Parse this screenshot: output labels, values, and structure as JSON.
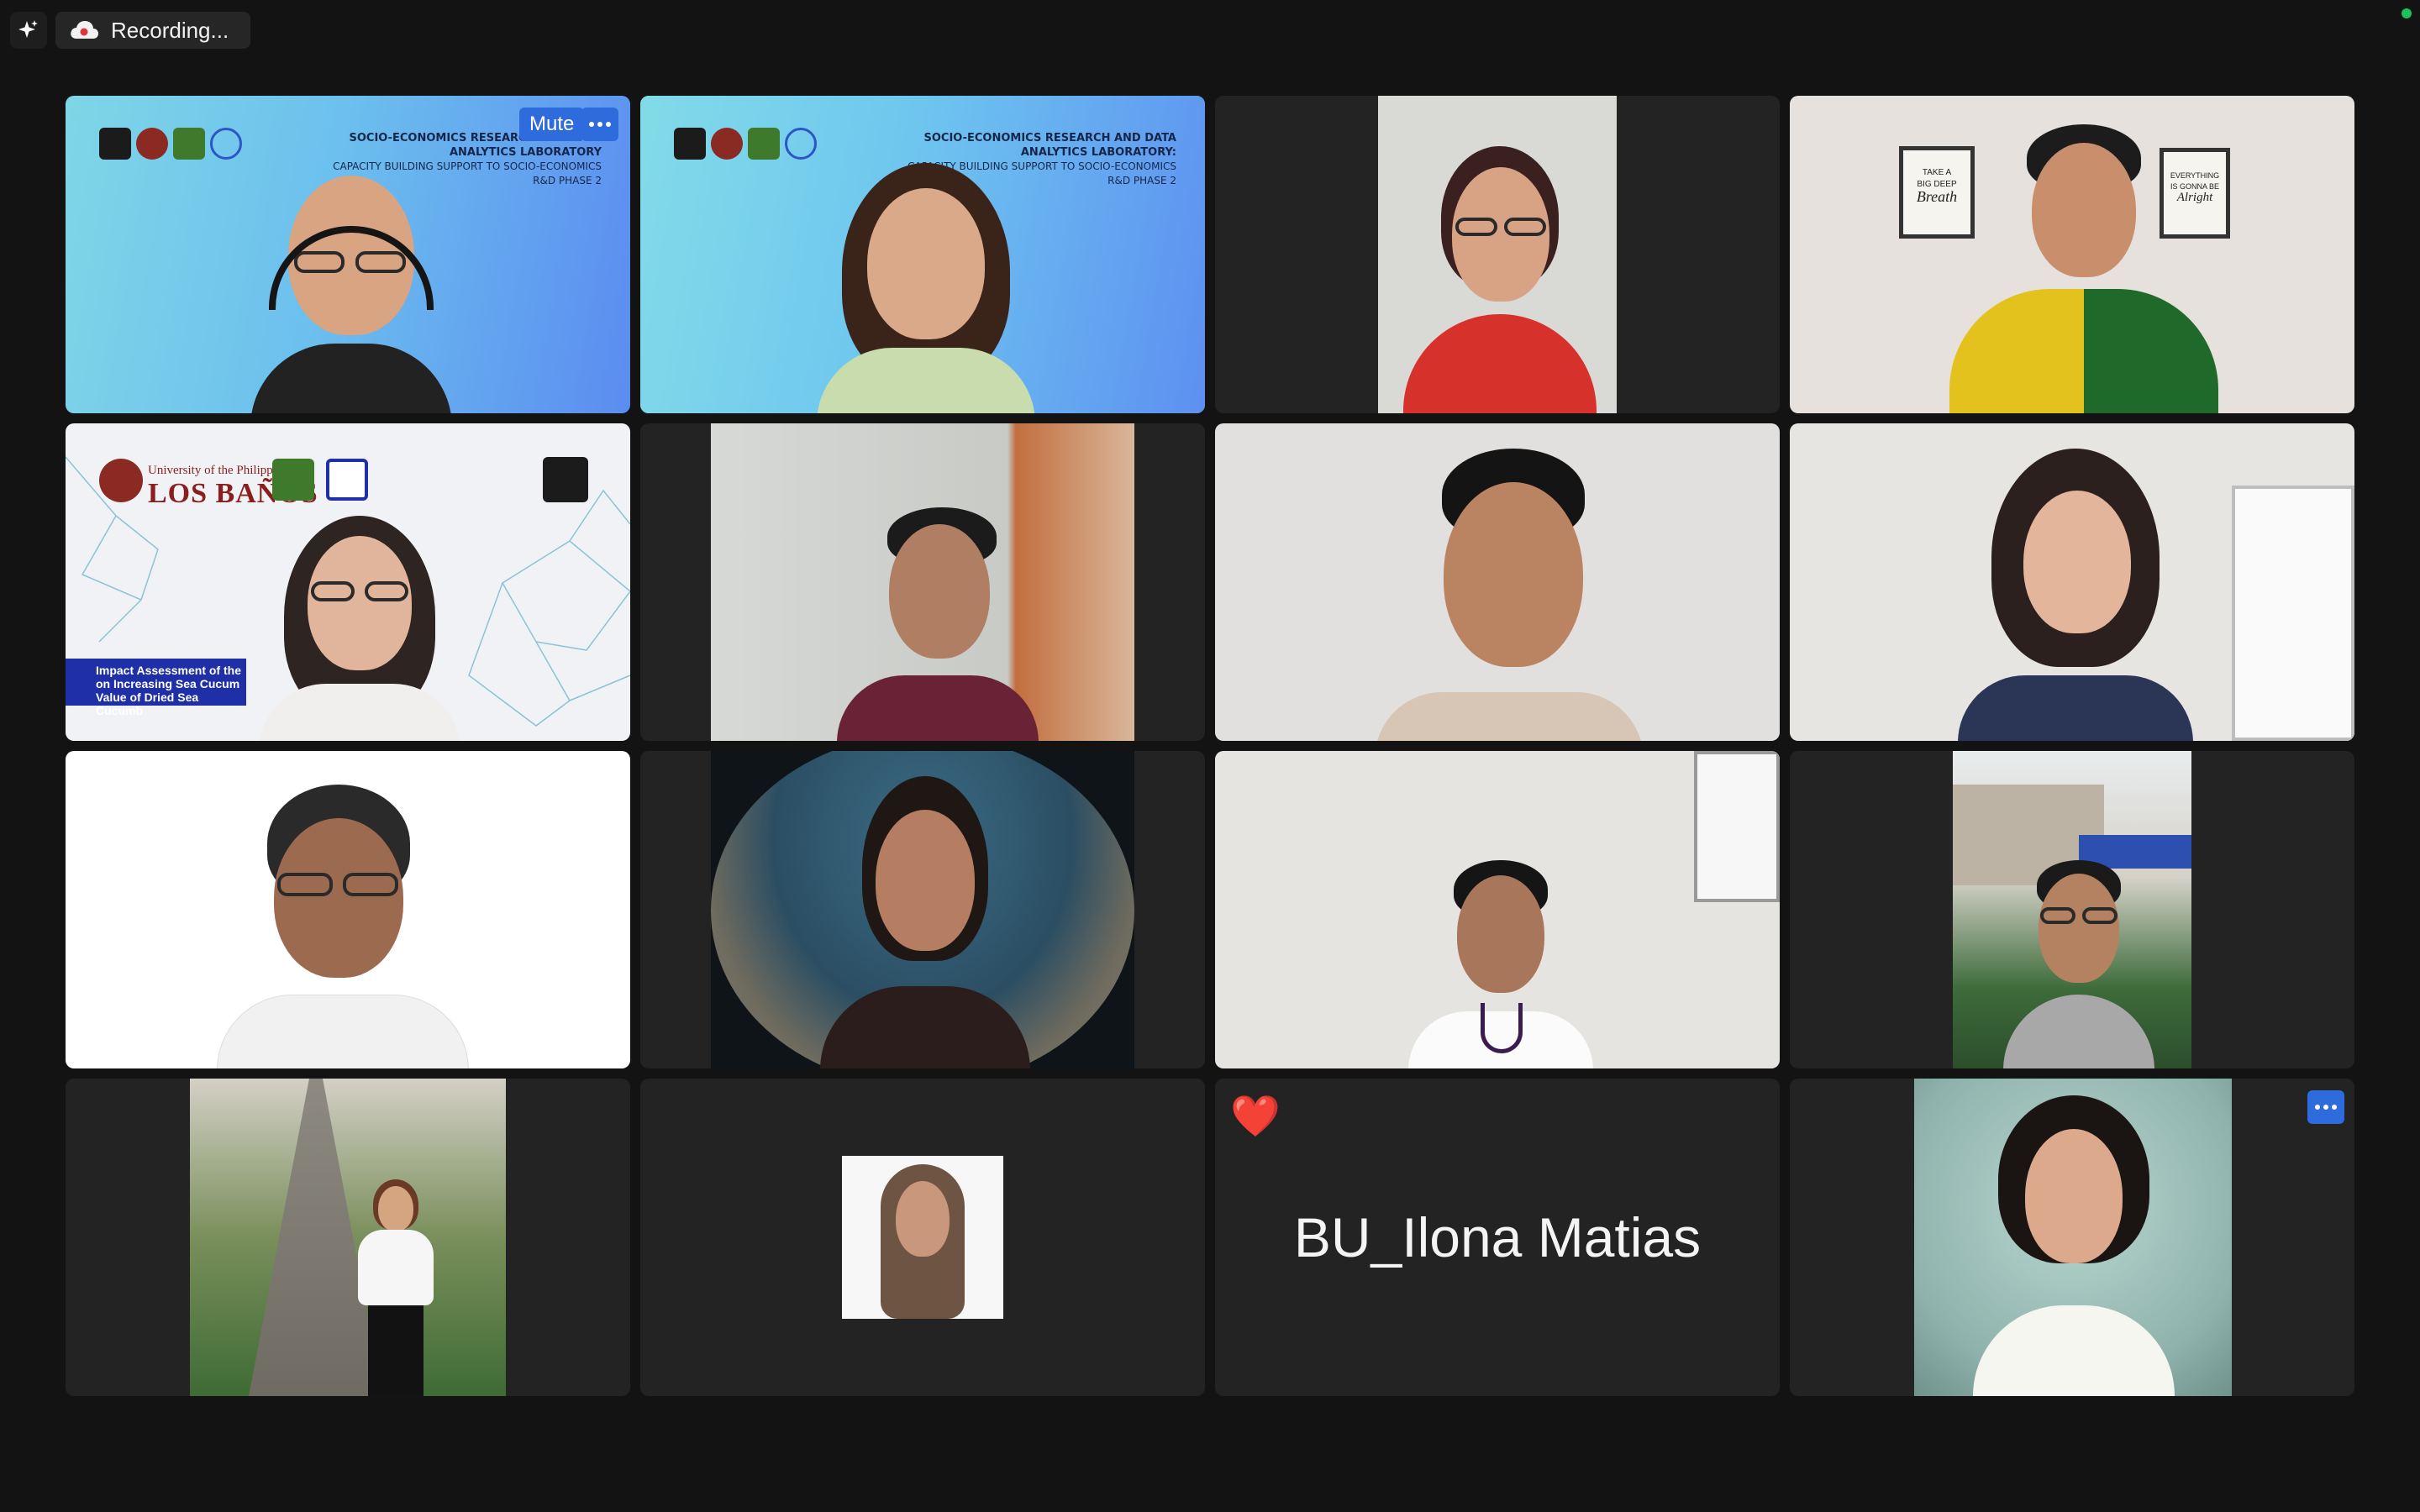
{
  "topbar": {
    "recording_label": "Recording...",
    "spark_icon": "sparkle-icon",
    "cloud_icon": "cloud-record-icon",
    "status_color": "#1ec15a"
  },
  "tile1": {
    "mute_label": "Mute",
    "banner_title": "SOCIO-ECONOMICS RESEARCH AND DATA ANALYTICS LABORATORY",
    "banner_subtitle": "CAPACITY BUILDING SUPPORT TO SOCIO-ECONOMICS R&D PHASE 2"
  },
  "tile2": {
    "banner_title": "SOCIO-ECONOMICS RESEARCH AND DATA ANALYTICS LABORATORY:",
    "banner_subtitle": "CAPACITY BUILDING SUPPORT TO SOCIO-ECONOMICS R&D PHASE 2",
    "highlight_color": "#7fd25a"
  },
  "tile5": {
    "uplb_small": "University of the Philippines",
    "uplb_big": "LOS BAÑOS",
    "caption_line1": "Impact Assessment of the",
    "caption_line2": "on Increasing Sea Cucum",
    "caption_line3": "Value of Dried Sea Cucumb"
  },
  "tile4": {
    "poster_left_line1": "TAKE A",
    "poster_left_line2": "BIG DEEP",
    "poster_left_line3": "Breath",
    "poster_right_line1": "EVERYTHING",
    "poster_right_line2": "IS GONNA BE",
    "poster_right_line3": "Alright"
  },
  "tile15": {
    "participant_name": "BU_Ilona Matias",
    "reaction": "❤️"
  },
  "accent_color": "#2e6bdc"
}
